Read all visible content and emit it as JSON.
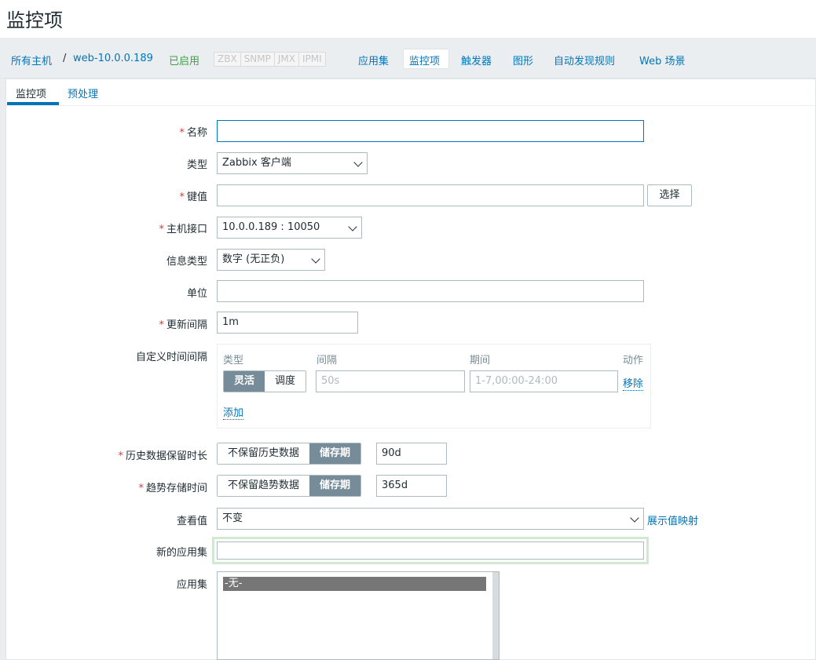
{
  "page": {
    "title": "监控项"
  },
  "breadcrumb": {
    "all_hosts": "所有主机",
    "separator": "/",
    "host": "web-10.0.0.189",
    "status": "已启用"
  },
  "protocols": [
    "ZBX",
    "SNMP",
    "JMX",
    "IPMI"
  ],
  "host_nav": [
    "应用集",
    "监控项",
    "触发器",
    "图形",
    "自动发现规则",
    "Web 场景"
  ],
  "tabs": {
    "items": "监控项",
    "preprocessing": "预处理"
  },
  "form": {
    "name": {
      "label": "名称",
      "value": ""
    },
    "type": {
      "label": "类型",
      "value": "Zabbix 客户端"
    },
    "key": {
      "label": "键值",
      "value": "",
      "select_button": "选择"
    },
    "interface": {
      "label": "主机接口",
      "value": "10.0.0.189 : 10050"
    },
    "info_type": {
      "label": "信息类型",
      "value": "数字 (无正负)"
    },
    "units": {
      "label": "单位",
      "value": ""
    },
    "update_interval": {
      "label": "更新间隔",
      "value": "1m"
    },
    "custom_intervals": {
      "label": "自定义时间间隔",
      "col_type": "类型",
      "col_interval": "间隔",
      "col_period": "期间",
      "col_action": "动作",
      "flexible": "灵活",
      "scheduling": "调度",
      "interval_placeholder": "50s",
      "period_placeholder": "1-7,00:00-24:00",
      "remove": "移除",
      "add": "添加"
    },
    "history": {
      "label": "历史数据保留时长",
      "no_keep": "不保留历史数据",
      "storage": "储存期",
      "value": "90d"
    },
    "trends": {
      "label": "趋势存储时间",
      "no_keep": "不保留趋势数据",
      "storage": "储存期",
      "value": "365d"
    },
    "show_value": {
      "label": "查看值",
      "value": "不变",
      "link": "展示值映射"
    },
    "new_application": {
      "label": "新的应用集",
      "value": ""
    },
    "applications": {
      "label": "应用集",
      "selected": "-无-"
    }
  }
}
